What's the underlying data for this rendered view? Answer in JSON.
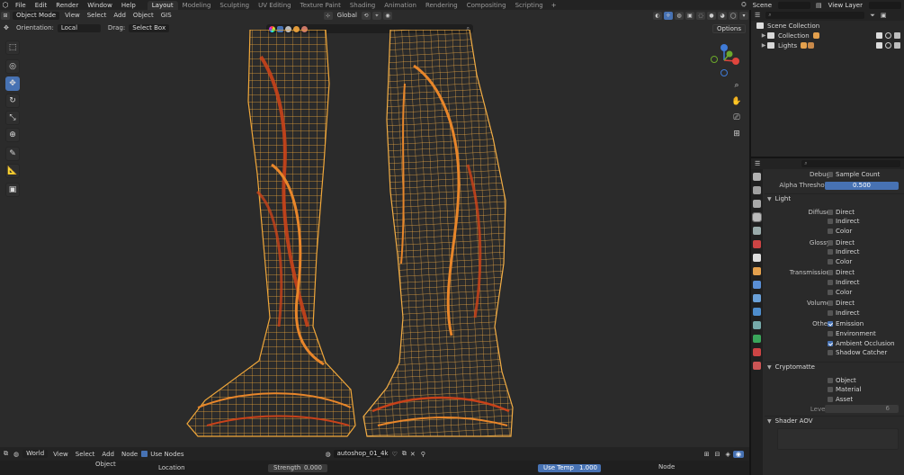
{
  "topbar": {
    "menus": [
      "File",
      "Edit",
      "Render",
      "Window",
      "Help"
    ],
    "workspaces": [
      {
        "label": "Layout",
        "active": true
      },
      {
        "label": "Modeling",
        "active": false
      },
      {
        "label": "Sculpting",
        "active": false
      },
      {
        "label": "UV Editing",
        "active": false
      },
      {
        "label": "Texture Paint",
        "active": false
      },
      {
        "label": "Shading",
        "active": false
      },
      {
        "label": "Animation",
        "active": false
      },
      {
        "label": "Rendering",
        "active": false
      },
      {
        "label": "Compositing",
        "active": false
      },
      {
        "label": "Scripting",
        "active": false
      }
    ],
    "add_workspace": "+",
    "scene_label": "Scene",
    "view_layer_label": "View Layer"
  },
  "viewport": {
    "mode": "Object Mode",
    "menus": [
      "View",
      "Select",
      "Add",
      "Object",
      "GIS"
    ],
    "transform_orientation": "Global",
    "orientation_label": "Orientation:",
    "orientation_value": "Local",
    "drag_label": "Drag:",
    "drag_value": "Select Box",
    "options_label": "Options",
    "gizmo": {
      "x_color": "#e0453d",
      "y_color": "#6ba82b",
      "z_color": "#3f7ad6"
    },
    "wire_colors": {
      "light": "#f0a73a",
      "mid": "#e8862a",
      "dark": "#c9421a"
    }
  },
  "toolbar": {
    "tools": [
      {
        "name": "select-box-tool",
        "glyph": "⬚",
        "active": false
      },
      {
        "name": "cursor-tool",
        "glyph": "◎",
        "active": false
      },
      {
        "name": "move-tool",
        "glyph": "✥",
        "active": true
      },
      {
        "name": "rotate-tool",
        "glyph": "↻",
        "active": false
      },
      {
        "name": "scale-tool",
        "glyph": "⤡",
        "active": false
      },
      {
        "name": "transform-tool",
        "glyph": "⊕",
        "active": false
      },
      {
        "name": "annotate-tool",
        "glyph": "✎",
        "active": false
      },
      {
        "name": "measure-tool",
        "glyph": "📐",
        "active": false
      },
      {
        "name": "add-cube-tool",
        "glyph": "▣",
        "active": false
      }
    ]
  },
  "outliner": {
    "root": "Scene Collection",
    "items": [
      {
        "label": "Collection",
        "icon_color": "#e3a04d"
      },
      {
        "label": "Lights",
        "icon_color": "#e3a04d"
      }
    ]
  },
  "properties": {
    "debug_label": "Debug",
    "sample_count": {
      "label": "Sample Count",
      "checked": false
    },
    "alpha_threshold": {
      "label": "Alpha Threshold",
      "value": "0.500"
    },
    "light_section": "Light",
    "groups": [
      {
        "label": "Diffuse",
        "options": [
          {
            "label": "Direct",
            "checked": false
          },
          {
            "label": "Indirect",
            "checked": false
          },
          {
            "label": "Color",
            "checked": false
          }
        ]
      },
      {
        "label": "Glossy",
        "options": [
          {
            "label": "Direct",
            "checked": false
          },
          {
            "label": "Indirect",
            "checked": false
          },
          {
            "label": "Color",
            "checked": false
          }
        ]
      },
      {
        "label": "Transmission",
        "options": [
          {
            "label": "Direct",
            "checked": false
          },
          {
            "label": "Indirect",
            "checked": false
          },
          {
            "label": "Color",
            "checked": false
          }
        ]
      },
      {
        "label": "Volume",
        "options": [
          {
            "label": "Direct",
            "checked": false
          },
          {
            "label": "Indirect",
            "checked": false
          }
        ]
      },
      {
        "label": "Other",
        "options": [
          {
            "label": "Emission",
            "checked": true
          },
          {
            "label": "Environment",
            "checked": false
          },
          {
            "label": "Ambient Occlusion",
            "checked": true
          },
          {
            "label": "Shadow Catcher",
            "checked": false
          }
        ]
      }
    ],
    "cryptomatte_section": "Cryptomatte",
    "cryptomatte": [
      {
        "label": "Object",
        "checked": false
      },
      {
        "label": "Material",
        "checked": false
      },
      {
        "label": "Asset",
        "checked": false
      }
    ],
    "levels": {
      "label": "Levels",
      "value": "6"
    },
    "shader_aov_section": "Shader AOV"
  },
  "shader_editor": {
    "world_label": "World",
    "menus": [
      "View",
      "Select",
      "Add",
      "Node"
    ],
    "use_nodes_label": "Use Nodes",
    "image_name": "autoshop_01_4k",
    "sub_labels": {
      "object": "Object",
      "location": "Location",
      "strength": "Strength",
      "strength_value": "0.000",
      "use_temp": "Use Temp",
      "use_temp_value": "1.000",
      "node": "Node"
    }
  }
}
